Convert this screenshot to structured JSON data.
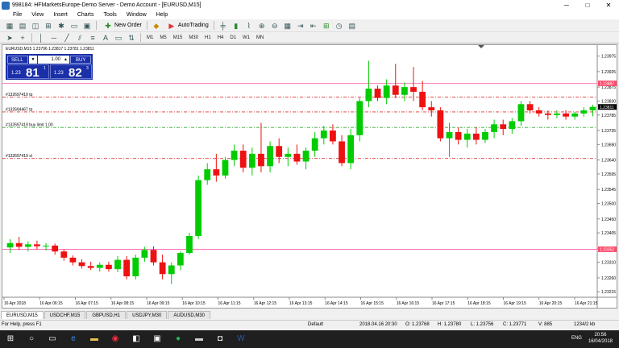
{
  "window": {
    "title": "998184: HFMarketsEurope-Demo Server - Demo Account - [EURUSD,M15]",
    "minimize": "─",
    "maximize": "□",
    "close": "✕"
  },
  "menu": [
    "File",
    "View",
    "Insert",
    "Charts",
    "Tools",
    "Window",
    "Help"
  ],
  "toolbar": {
    "new_order": "New Order",
    "autotrading": "AutoTrading",
    "timeframes": [
      "M1",
      "M5",
      "M15",
      "M30",
      "H1",
      "H4",
      "D1",
      "W1",
      "MN"
    ]
  },
  "chart": {
    "symbol_header": "EURUSD,M15  1.23796 1.23817 1.23781 1.23811",
    "trade_panel": {
      "sell_label": "SELL",
      "buy_label": "BUY",
      "lot": "1.00",
      "sell_small": "1.23",
      "sell_big": "81",
      "sell_sup": "1",
      "buy_small": "1.23",
      "buy_big": "82",
      "buy_sup": "3"
    },
    "order_labels": [
      {
        "text": "#132697419 tp"
      },
      {
        "text": "#132694467 tp"
      },
      {
        "text": "#132697419 buy limit 1.00"
      },
      {
        "text": "#132697419 sl"
      }
    ]
  },
  "chart_data": {
    "type": "candlestick",
    "y_ticks": [
      "1.23975",
      "1.23925",
      "1.23875",
      "1.23830",
      "1.23785",
      "1.23735",
      "1.23690",
      "1.23640",
      "1.23595",
      "1.23545",
      "1.23500",
      "1.23450",
      "1.23405",
      "1.23355",
      "1.23310",
      "1.23260",
      "1.23215"
    ],
    "x_ticks": [
      "16 Apr 2018",
      "16 Apr 06:15",
      "16 Apr 07:15",
      "16 Apr 08:15",
      "16 Apr 09:15",
      "16 Apr 10:15",
      "16 Apr 11:15",
      "16 Apr 12:15",
      "16 Apr 13:15",
      "16 Apr 14:15",
      "16 Apr 15:15",
      "16 Apr 16:15",
      "16 Apr 17:15",
      "16 Apr 18:15",
      "16 Apr 19:15",
      "16 Apr 20:15",
      "16 Apr 21:15"
    ],
    "ylim": [
      1.232,
      1.24
    ],
    "price_markers": [
      {
        "price": "1.23887",
        "value": 1.23887,
        "color": "#ff4d6d"
      },
      {
        "price": "1.23811",
        "value": 1.23811,
        "color": "#000000"
      },
      {
        "price": "1.23352",
        "value": 1.23352,
        "color": "#ff4d6d"
      }
    ],
    "horizontal_lines": [
      {
        "value": 1.23887,
        "color": "#ff66aa",
        "style": "solid"
      },
      {
        "value": 1.23843,
        "color": "#dd3333",
        "style": "dashdot"
      },
      {
        "value": 1.23795,
        "color": "#dd3333",
        "style": "dashdot"
      },
      {
        "value": 1.23745,
        "color": "#33aa33",
        "style": "dashdot"
      },
      {
        "value": 1.23645,
        "color": "#dd3333",
        "style": "dashdot"
      },
      {
        "value": 1.23352,
        "color": "#ff44aa",
        "style": "solid"
      }
    ],
    "candles": [
      {
        "o": 1.23358,
        "h": 1.23385,
        "l": 1.2334,
        "c": 1.23372
      },
      {
        "o": 1.23372,
        "h": 1.23392,
        "l": 1.2335,
        "c": 1.2336
      },
      {
        "o": 1.2336,
        "h": 1.23378,
        "l": 1.23345,
        "c": 1.23368
      },
      {
        "o": 1.23368,
        "h": 1.2338,
        "l": 1.23352,
        "c": 1.23362
      },
      {
        "o": 1.23362,
        "h": 1.23372,
        "l": 1.23348,
        "c": 1.23364
      },
      {
        "o": 1.23364,
        "h": 1.2337,
        "l": 1.23335,
        "c": 1.23345
      },
      {
        "o": 1.23345,
        "h": 1.23352,
        "l": 1.23315,
        "c": 1.23325
      },
      {
        "o": 1.23325,
        "h": 1.23332,
        "l": 1.233,
        "c": 1.2331
      },
      {
        "o": 1.2331,
        "h": 1.2332,
        "l": 1.2329,
        "c": 1.23298
      },
      {
        "o": 1.23298,
        "h": 1.23312,
        "l": 1.23285,
        "c": 1.23292
      },
      {
        "o": 1.23292,
        "h": 1.2331,
        "l": 1.2328,
        "c": 1.23302
      },
      {
        "o": 1.23302,
        "h": 1.23312,
        "l": 1.2328,
        "c": 1.23288
      },
      {
        "o": 1.23288,
        "h": 1.2333,
        "l": 1.23278,
        "c": 1.23318
      },
      {
        "o": 1.23318,
        "h": 1.2333,
        "l": 1.23255,
        "c": 1.23265
      },
      {
        "o": 1.23265,
        "h": 1.23335,
        "l": 1.23255,
        "c": 1.23325
      },
      {
        "o": 1.23325,
        "h": 1.2336,
        "l": 1.23312,
        "c": 1.2335
      },
      {
        "o": 1.2335,
        "h": 1.23362,
        "l": 1.233,
        "c": 1.2331
      },
      {
        "o": 1.2331,
        "h": 1.23335,
        "l": 1.23255,
        "c": 1.23272
      },
      {
        "o": 1.23272,
        "h": 1.2331,
        "l": 1.2324,
        "c": 1.233
      },
      {
        "o": 1.233,
        "h": 1.23345,
        "l": 1.23285,
        "c": 1.2334
      },
      {
        "o": 1.2334,
        "h": 1.23405,
        "l": 1.23335,
        "c": 1.23395
      },
      {
        "o": 1.23395,
        "h": 1.2359,
        "l": 1.23385,
        "c": 1.23575
      },
      {
        "o": 1.23575,
        "h": 1.2363,
        "l": 1.2356,
        "c": 1.2361
      },
      {
        "o": 1.2361,
        "h": 1.2366,
        "l": 1.2357,
        "c": 1.2359
      },
      {
        "o": 1.2359,
        "h": 1.2365,
        "l": 1.2358,
        "c": 1.2364
      },
      {
        "o": 1.2364,
        "h": 1.2369,
        "l": 1.2362,
        "c": 1.2367
      },
      {
        "o": 1.2367,
        "h": 1.2369,
        "l": 1.236,
        "c": 1.23615
      },
      {
        "o": 1.23615,
        "h": 1.2368,
        "l": 1.2359,
        "c": 1.2366
      },
      {
        "o": 1.2366,
        "h": 1.2376,
        "l": 1.236,
        "c": 1.2362
      },
      {
        "o": 1.2362,
        "h": 1.237,
        "l": 1.236,
        "c": 1.23685
      },
      {
        "o": 1.23685,
        "h": 1.2371,
        "l": 1.2363,
        "c": 1.2365
      },
      {
        "o": 1.2365,
        "h": 1.2368,
        "l": 1.2362,
        "c": 1.2366
      },
      {
        "o": 1.2366,
        "h": 1.2369,
        "l": 1.23625,
        "c": 1.23635
      },
      {
        "o": 1.23635,
        "h": 1.2368,
        "l": 1.2361,
        "c": 1.2367
      },
      {
        "o": 1.2367,
        "h": 1.2373,
        "l": 1.2365,
        "c": 1.2371
      },
      {
        "o": 1.2371,
        "h": 1.2375,
        "l": 1.2369,
        "c": 1.23735
      },
      {
        "o": 1.23735,
        "h": 1.23755,
        "l": 1.2369,
        "c": 1.237
      },
      {
        "o": 1.237,
        "h": 1.2372,
        "l": 1.2362,
        "c": 1.2363
      },
      {
        "o": 1.2363,
        "h": 1.2374,
        "l": 1.2361,
        "c": 1.2372
      },
      {
        "o": 1.2372,
        "h": 1.2384,
        "l": 1.237,
        "c": 1.2383
      },
      {
        "o": 1.2383,
        "h": 1.2396,
        "l": 1.2381,
        "c": 1.2387
      },
      {
        "o": 1.2387,
        "h": 1.2388,
        "l": 1.2383,
        "c": 1.2384
      },
      {
        "o": 1.2384,
        "h": 1.239,
        "l": 1.2382,
        "c": 1.2388
      },
      {
        "o": 1.2388,
        "h": 1.2395,
        "l": 1.2384,
        "c": 1.2385
      },
      {
        "o": 1.2385,
        "h": 1.2389,
        "l": 1.2383,
        "c": 1.23875
      },
      {
        "o": 1.23875,
        "h": 1.2394,
        "l": 1.2383,
        "c": 1.2386
      },
      {
        "o": 1.2386,
        "h": 1.23895,
        "l": 1.238,
        "c": 1.2381
      },
      {
        "o": 1.2381,
        "h": 1.2383,
        "l": 1.2378,
        "c": 1.238
      },
      {
        "o": 1.238,
        "h": 1.2381,
        "l": 1.237,
        "c": 1.2371
      },
      {
        "o": 1.2371,
        "h": 1.2376,
        "l": 1.2365,
        "c": 1.2373
      },
      {
        "o": 1.2373,
        "h": 1.23745,
        "l": 1.2369,
        "c": 1.23705
      },
      {
        "o": 1.23705,
        "h": 1.2374,
        "l": 1.2368,
        "c": 1.23725
      },
      {
        "o": 1.23725,
        "h": 1.23745,
        "l": 1.2369,
        "c": 1.23705
      },
      {
        "o": 1.23705,
        "h": 1.2374,
        "l": 1.23695,
        "c": 1.2373
      },
      {
        "o": 1.2373,
        "h": 1.2377,
        "l": 1.2371,
        "c": 1.23755
      },
      {
        "o": 1.23755,
        "h": 1.2377,
        "l": 1.2372,
        "c": 1.2374
      },
      {
        "o": 1.2374,
        "h": 1.23775,
        "l": 1.23725,
        "c": 1.23765
      },
      {
        "o": 1.23765,
        "h": 1.2383,
        "l": 1.2375,
        "c": 1.2382
      },
      {
        "o": 1.2382,
        "h": 1.2383,
        "l": 1.2379,
        "c": 1.238
      },
      {
        "o": 1.238,
        "h": 1.2381,
        "l": 1.2378,
        "c": 1.2379
      },
      {
        "o": 1.2379,
        "h": 1.238,
        "l": 1.2377,
        "c": 1.23785
      },
      {
        "o": 1.23785,
        "h": 1.238,
        "l": 1.23775,
        "c": 1.2379
      },
      {
        "o": 1.2379,
        "h": 1.238,
        "l": 1.2377,
        "c": 1.2378
      },
      {
        "o": 1.2378,
        "h": 1.23795,
        "l": 1.2377,
        "c": 1.2379
      },
      {
        "o": 1.2379,
        "h": 1.2381,
        "l": 1.2378,
        "c": 1.238
      },
      {
        "o": 1.238,
        "h": 1.23818,
        "l": 1.23781,
        "c": 1.23811
      }
    ],
    "bull_color": "#00cc00",
    "bear_color": "#ee1111"
  },
  "tabs": [
    "EURUSD,M15",
    "USDCHF,M15",
    "GBPUSD,H1",
    "USDJPY,M30",
    "AUDUSD,M30"
  ],
  "status": {
    "help": "For Help, press F1",
    "profile": "Default",
    "datetime": "2018.04.16 20:30",
    "open": "O: 1.23768",
    "high": "H: 1.23780",
    "low": "L: 1.23756",
    "close": "C: 1.23771",
    "volume": "V: 885",
    "traffic": "1234/2 kb"
  },
  "taskbar": {
    "lang": "ENG",
    "time": "20:56",
    "date": "16/04/2018"
  }
}
